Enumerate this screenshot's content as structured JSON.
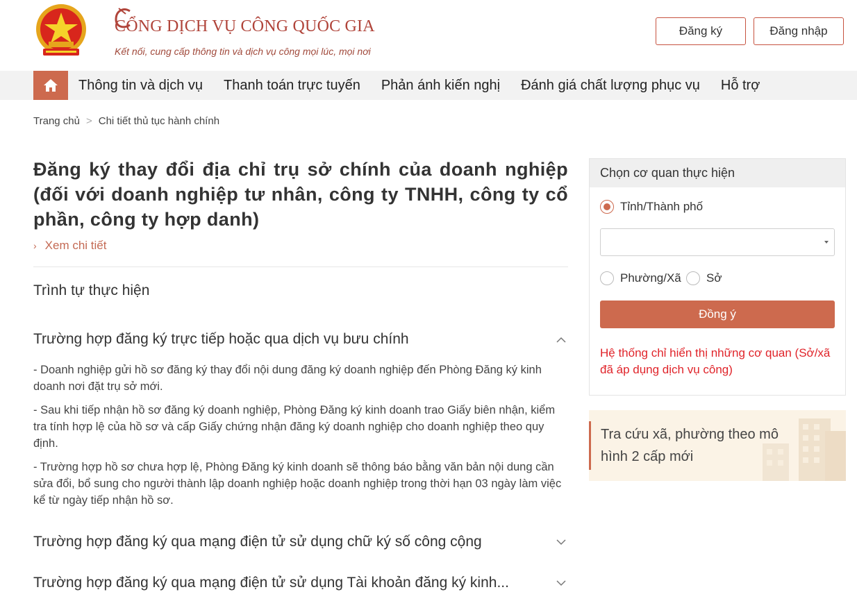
{
  "header": {
    "brand_title": "CỔNG DỊCH VỤ CÔNG QUỐC GIA",
    "brand_subtitle": "Kết nối, cung cấp thông tin và dịch vụ công mọi lúc, mọi nơi",
    "register_label": "Đăng ký",
    "login_label": "Đăng nhập",
    "emblem_icon": "national-emblem-icon"
  },
  "nav": {
    "home_icon": "home-icon",
    "items": [
      {
        "label": "Thông tin và dịch vụ"
      },
      {
        "label": "Thanh toán trực tuyến"
      },
      {
        "label": "Phản ánh kiến nghị"
      },
      {
        "label": "Đánh giá chất lượng phục vụ"
      },
      {
        "label": "Hỗ trợ"
      }
    ]
  },
  "breadcrumb": {
    "home": "Trang chủ",
    "separator": ">",
    "current": "Chi tiết thủ tục hành chính"
  },
  "main": {
    "title": "Đăng ký thay đổi địa chỉ trụ sở chính của doanh nghiệp (đối với doanh nghiệp tư nhân, công ty TNHH, công ty cổ phần, công ty hợp danh)",
    "detail_link": "Xem chi tiết",
    "section_title": "Trình tự thực hiện",
    "accordions": [
      {
        "title": "Trường hợp đăng ký trực tiếp hoặc qua dịch vụ bưu chính",
        "expanded": true,
        "paragraphs": [
          "- Doanh nghiệp gửi hồ sơ đăng ký thay đổi nội dung đăng ký doanh nghiệp đến Phòng Đăng ký kinh doanh nơi đặt trụ sở mới.",
          "- Sau khi tiếp nhận hồ sơ đăng ký doanh nghiệp, Phòng Đăng ký kinh doanh trao Giấy biên nhận, kiểm tra tính hợp lệ của hồ sơ và cấp Giấy chứng nhận đăng ký doanh nghiệp cho doanh nghiệp theo quy định.",
          "- Trường hợp hồ sơ chưa hợp lệ, Phòng Đăng ký kinh doanh sẽ thông báo bằng văn bản nội dung cần sửa đổi, bổ sung cho người thành lập doanh nghiệp hoặc doanh nghiệp trong thời hạn 03 ngày làm việc kể từ ngày tiếp nhận hồ sơ."
        ]
      },
      {
        "title": "Trường hợp đăng ký qua mạng điện tử sử dụng chữ ký số công cộng",
        "expanded": false
      },
      {
        "title": "Trường hợp đăng ký qua mạng điện tử sử dụng Tài khoản đăng ký kinh...",
        "expanded": false
      }
    ]
  },
  "panel": {
    "title": "Chọn cơ quan thực hiện",
    "option_province": "Tỉnh/Thành phố",
    "select_value": "",
    "option_ward": "Phường/Xã",
    "option_department": "Sở",
    "agree_label": "Đồng ý",
    "notice": "Hệ thống chỉ hiển thị những cơ quan (Sở/xã đã áp dụng dịch vụ công)"
  },
  "promo": {
    "text": "Tra cứu xã, phường theo mô hình 2 cấp mới"
  },
  "colors": {
    "accent": "#cd6a4e",
    "brand": "#b0443a",
    "notice": "#e0242a"
  }
}
